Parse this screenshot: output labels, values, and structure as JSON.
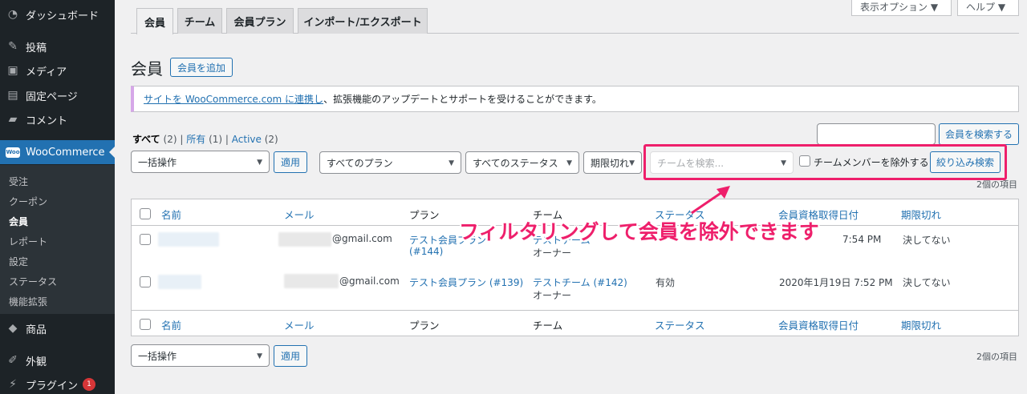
{
  "sidebar": {
    "items": [
      {
        "label": "ダッシュボード",
        "icon": "dashboard-icon"
      },
      {
        "label": "投稿",
        "icon": "pin-icon"
      },
      {
        "label": "メディア",
        "icon": "media-icon"
      },
      {
        "label": "固定ページ",
        "icon": "page-icon"
      },
      {
        "label": "コメント",
        "icon": "comment-icon"
      },
      {
        "label": "WooCommerce",
        "icon": "woocommerce-icon",
        "logo_text": "Woo"
      },
      {
        "label": "商品",
        "icon": "product-icon"
      },
      {
        "label": "外観",
        "icon": "appearance-icon"
      },
      {
        "label": "プラグイン",
        "icon": "plugin-icon",
        "badge": "1"
      }
    ],
    "submenu": [
      "受注",
      "クーポン",
      "会員",
      "レポート",
      "設定",
      "ステータス",
      "機能拡張"
    ]
  },
  "screen_meta": {
    "options": "表示オプション ▼",
    "help": "ヘルプ ▼"
  },
  "tabs": [
    "会員",
    "チーム",
    "会員プラン",
    "インポート/エクスポート"
  ],
  "heading": {
    "title": "会員",
    "add_button": "会員を追加"
  },
  "notice": {
    "link_text": "サイトを WooCommerce.com に連携し",
    "rest": "、拡張機能のアップデートとサポートを受けることができます。"
  },
  "views": {
    "all_label": "すべて",
    "all_count": "(2)",
    "sep": "|",
    "owned_label": "所有",
    "owned_count": "(1)",
    "active_label": "Active",
    "active_count": "(2)"
  },
  "search_button": "会員を検索する",
  "filters": {
    "bulk": "一括操作",
    "apply": "適用",
    "plans": "すべてのプラン",
    "statuses": "すべてのステータス",
    "expiry": "期限切れ",
    "team_placeholder": "チームを検索...",
    "exclude_label": "チームメンバーを除外する",
    "filter_button": "絞り込み検索"
  },
  "items_count": "2個の項目",
  "annotation": "フィルタリングして会員を除外できます",
  "columns": [
    "名前",
    "メール",
    "プラン",
    "チーム",
    "ステータス",
    "会員資格取得日付",
    "期限切れ"
  ],
  "rows": [
    {
      "email": "@gmail.com",
      "plan": "テスト会員プラン",
      "plan_id": "(#144)",
      "team": "テストチーム",
      "role": "オーナー",
      "date": "7:54 PM",
      "expires": "決してない"
    },
    {
      "email": "@gmail.com",
      "plan": "テスト会員プラン (#139)",
      "team": "テストチーム (#142)",
      "role": "オーナー",
      "status": "有効",
      "date": "2020年1月19日 7:52 PM",
      "expires": "決してない"
    }
  ],
  "colors": {
    "sidebar": "#1d2327",
    "accent": "#2271b1",
    "highlight": "#ee1f6b",
    "badge": "#d63638"
  }
}
